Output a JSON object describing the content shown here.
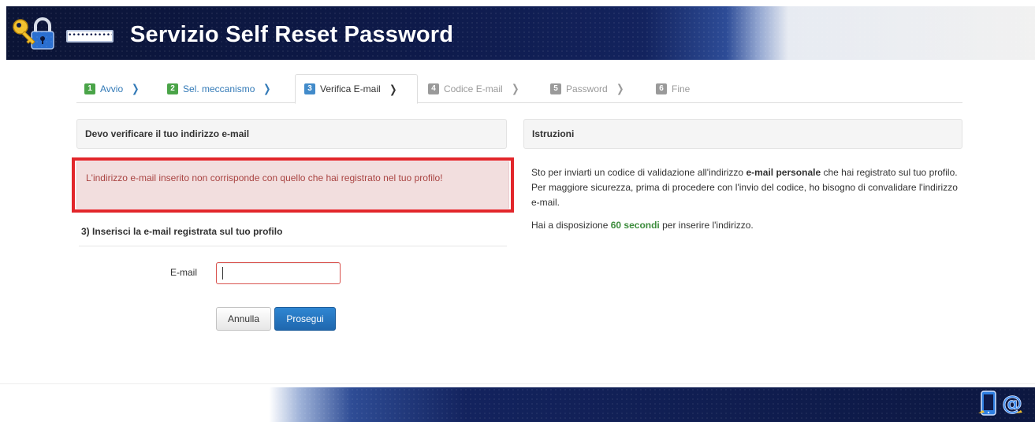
{
  "header": {
    "title": "Servizio Self Reset Password",
    "password_mask": "•••••••••••"
  },
  "wizard": {
    "steps": [
      {
        "number": "1",
        "label": "Avvio",
        "state": "done"
      },
      {
        "number": "2",
        "label": "Sel. meccanismo",
        "state": "done"
      },
      {
        "number": "3",
        "label": "Verifica E-mail",
        "state": "active"
      },
      {
        "number": "4",
        "label": "Codice E-mail",
        "state": "future"
      },
      {
        "number": "5",
        "label": "Password",
        "state": "future"
      },
      {
        "number": "6",
        "label": "Fine",
        "state": "future"
      }
    ],
    "separator": "❯"
  },
  "left_panel": {
    "heading": "Devo verificare il tuo indirizzo e-mail",
    "alert": "L'indirizzo e-mail inserito non corrisponde con quello che hai registrato nel tuo profilo!",
    "section_title": "3) Inserisci la e-mail registrata sul tuo profilo",
    "email_label": "E-mail",
    "email_value": "",
    "cancel_label": "Annulla",
    "continue_label": "Prosegui"
  },
  "right_panel": {
    "heading": "Istruzioni",
    "line1_before": "Sto per inviarti un codice di validazione all'indirizzo ",
    "line1_bold": "e-mail personale",
    "line1_after": " che hai registrato sul tuo profilo.",
    "line2": "Per maggiore sicurezza, prima di procedere con l'invio del codice, ho bisogno di convalidare l'indirizzo e-mail.",
    "line3_before": "Hai a disposizione ",
    "line3_highlight": "60 secondi",
    "line3_after": " per inserire l'indirizzo."
  },
  "colors": {
    "alert_outline": "#e2262b",
    "alert_text": "#a94442",
    "highlight_green": "#3c8c3c",
    "primary_button": "#1f67ae"
  },
  "icons": {
    "logo": "key-lock-icon",
    "footer": [
      "phone-icon",
      "at-sign-icon"
    ]
  }
}
